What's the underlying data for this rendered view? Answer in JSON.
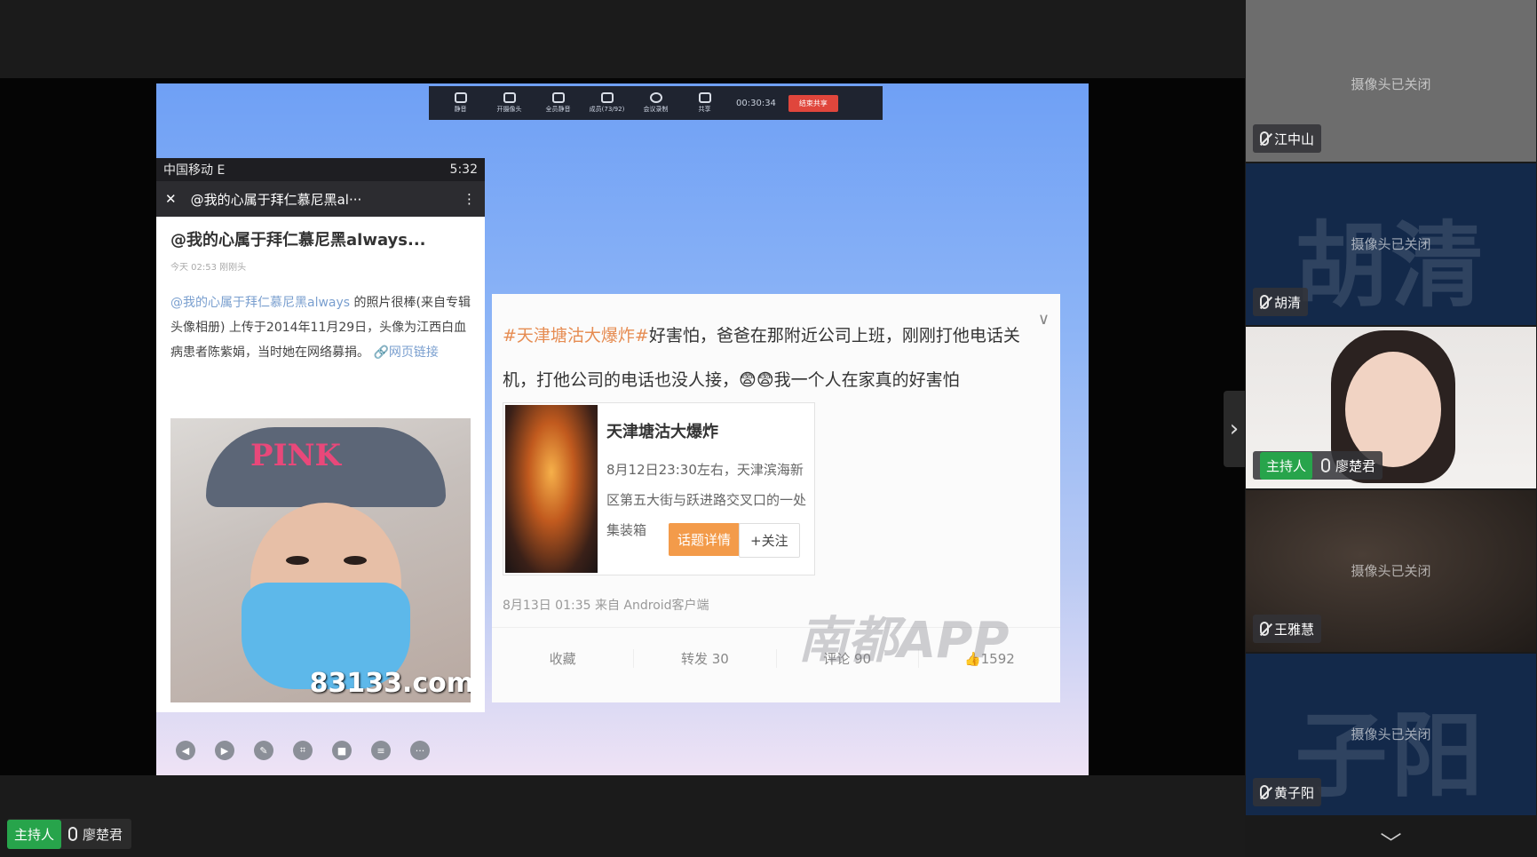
{
  "toolbar": {
    "items": [
      "静音",
      "开摄像头",
      "全员静音",
      "成员(73/92)",
      "会议录制",
      "共享"
    ],
    "timer": "00:30:34",
    "end_label": "结束共享"
  },
  "phone": {
    "carrier": "中国移动 E",
    "time": "5:32",
    "nav_title": "@我的心属于拜仁慕尼黑al···",
    "post_title": "@我的心属于拜仁慕尼黑always...",
    "post_meta": "今天 02:53 刚刚头",
    "post_mention": "@我的心属于拜仁慕尼黑always",
    "post_body": " 的照片很棒(来自专辑 头像相册) 上传于2014年11月29日，头像为江西白血病患者陈紫娟，当时她在网络募捐。",
    "post_link": "网页链接",
    "photo_watermark": "83133.com",
    "cap_text": "PINK"
  },
  "weibo": {
    "hashtag": "#天津塘沽大爆炸#",
    "body": "好害怕，爸爸在那附近公司上班，刚刚打他电话关机，打他公司的电话也没人接，",
    "body2": "我一个人在家真的好害怕",
    "news_title": "天津塘沽大爆炸",
    "news_desc": "8月12日23:30左右，天津滨海新区第五大街与跃进路交叉口的一处集装箱",
    "news_btn": "话题详情",
    "follow_btn": "+关注",
    "time": "8月13日 01:35 来自 Android客户端",
    "actions": [
      "收藏",
      "转发 30",
      "评论 90",
      "1592"
    ],
    "watermark": "南都APP"
  },
  "host_label": {
    "tag": "主持人",
    "name": "廖楚君"
  },
  "participants": [
    {
      "name": "江中山",
      "status": "摄像头已关闭",
      "bg": "#6d6d6d",
      "big": ""
    },
    {
      "name": "胡清",
      "status": "摄像头已关闭",
      "bg": "#13294a",
      "big": "胡清"
    },
    {
      "name": "廖楚君",
      "status": "",
      "bg": "#e9e6e4",
      "big": "",
      "host": "主持人"
    },
    {
      "name": "王雅慧",
      "status": "摄像头已关闭",
      "bg": "#2a2522",
      "big": ""
    },
    {
      "name": "黄子阳",
      "status": "摄像头已关闭",
      "bg": "#13294a",
      "big": "子阳"
    }
  ]
}
